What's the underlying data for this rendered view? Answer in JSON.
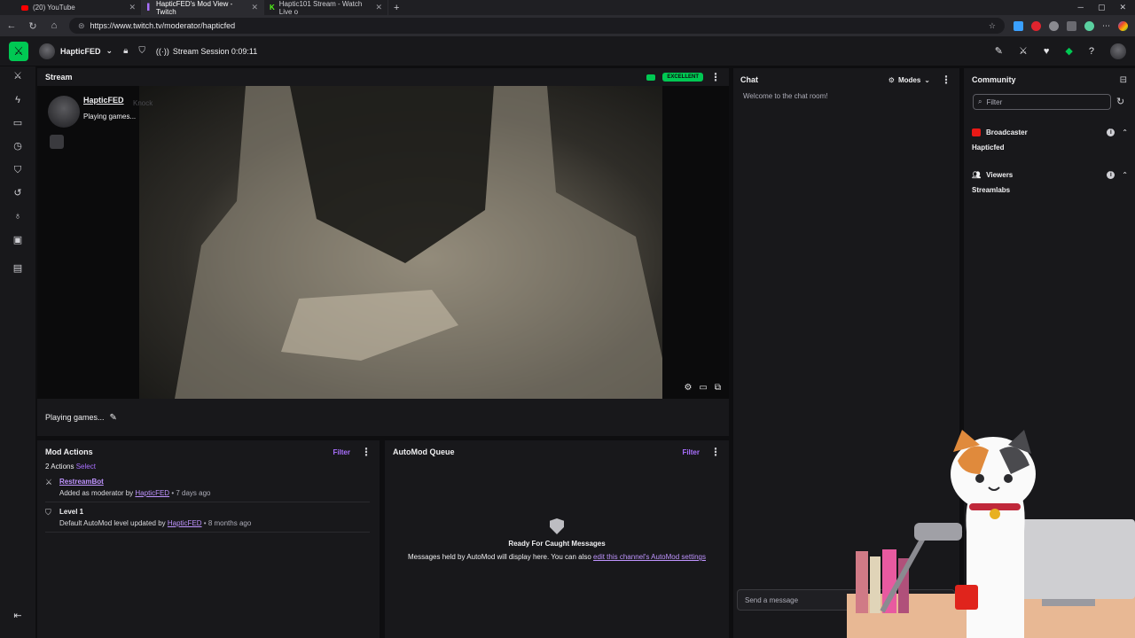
{
  "browser": {
    "tabs": [
      {
        "label": "(20) YouTube",
        "active": false
      },
      {
        "label": "HapticFED's Mod View - Twitch",
        "active": true
      },
      {
        "label": "Haptic101 Stream - Watch Live o",
        "active": false
      }
    ],
    "url": "https://www.twitch.tv/moderator/hapticfed"
  },
  "header": {
    "channel_name": "HapticFED",
    "session_label": "Stream Session 0:09:11"
  },
  "stream": {
    "title": "Stream",
    "quality_badge": "EXCELLENT",
    "overlay_channel": "HapticFED",
    "overlay_game": "Playing games...",
    "overlay_knock": "Knock",
    "stream_title": "Playing games..."
  },
  "mod_actions": {
    "title": "Mod Actions",
    "filter": "Filter",
    "count_text": "2 Actions",
    "select": "Select",
    "items": [
      {
        "name": "RestreamBot",
        "desc": "Added as moderator by",
        "by": "HapticFED",
        "time": "• 7 days ago"
      },
      {
        "name": "Level 1",
        "desc": "Default AutoMod level updated by",
        "by": "HapticFED",
        "time": "• 8 months ago"
      }
    ]
  },
  "automod": {
    "title": "AutoMod Queue",
    "filter": "Filter",
    "empty_title": "Ready For Caught Messages",
    "empty_body": "Messages held by AutoMod will display here. You can also",
    "empty_link": "edit this channel's AutoMod settings"
  },
  "chat": {
    "title": "Chat",
    "modes": "Modes",
    "welcome": "Welcome to the chat room!",
    "send_placeholder": "Send a message"
  },
  "community": {
    "title": "Community",
    "filter_placeholder": "Filter",
    "broadcaster_label": "Broadcaster",
    "broadcaster_name": "Hapticfed",
    "viewers_label": "Viewers",
    "viewer_name": "Streamlabs"
  },
  "colors": {
    "accent": "#a970ff",
    "excellent": "#00c853",
    "background": "#0e0e10",
    "panel": "#18181b"
  }
}
